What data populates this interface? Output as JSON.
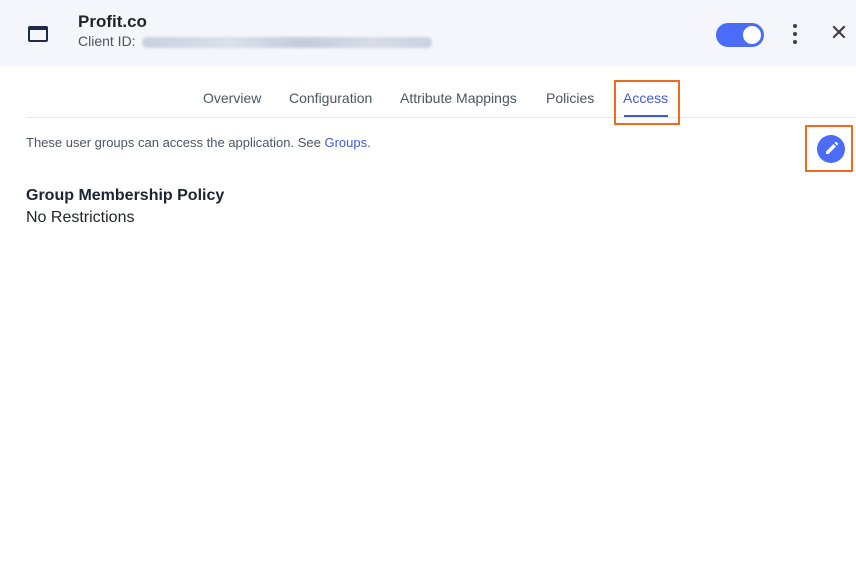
{
  "header": {
    "app_icon": "window-icon",
    "title": "Profit.co",
    "client_id_label": "Client ID:",
    "toggle_state": "on",
    "more_icon": "kebab-menu-icon",
    "close_icon": "close-icon"
  },
  "tabs": [
    {
      "label": "Overview"
    },
    {
      "label": "Configuration"
    },
    {
      "label": "Attribute Mappings"
    },
    {
      "label": "Policies"
    },
    {
      "label": "Access",
      "active": true
    }
  ],
  "access": {
    "description_prefix": "These user groups can access the application. See ",
    "groups_link": "Groups",
    "description_suffix": ".",
    "edit_icon": "pencil-icon",
    "section_title": "Group Membership Policy",
    "section_value": "No Restrictions"
  },
  "colors": {
    "accent": "#4a6cf7",
    "highlight": "#f06a1d",
    "header_bg": "#f5f6fb"
  }
}
